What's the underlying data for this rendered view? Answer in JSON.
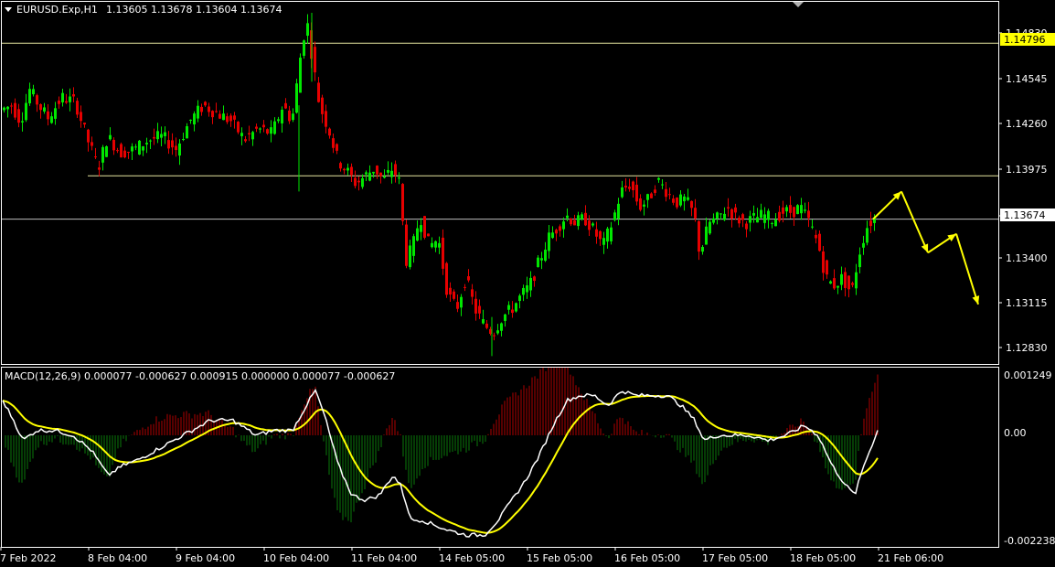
{
  "header": {
    "symbol": "EURUSD.Exp,H1",
    "quote": "1.13605 1.13678 1.13604 1.13674"
  },
  "price_axis": {
    "ticks": [
      "1.14830",
      "1.14545",
      "1.14260",
      "1.13975",
      "1.13685",
      "1.13400",
      "1.13115",
      "1.12830"
    ],
    "tag_upper": "1.14796",
    "tag_current": "1.13674"
  },
  "macd": {
    "label": "MACD(12,26,9) 0.000077 -0.000627 0.000915 0.000000 0.000077 -0.000627",
    "ticks": [
      "0.001249",
      "0.00",
      "-0.002238"
    ]
  },
  "time_axis": {
    "labels": [
      "7 Feb 2022",
      "8 Feb 04:00",
      "9 Feb 04:00",
      "10 Feb 04:00",
      "11 Feb 04:00",
      "14 Feb 05:00",
      "15 Feb 05:00",
      "16 Feb 05:00",
      "17 Feb 05:00",
      "18 Feb 05:00",
      "21 Feb 06:00"
    ]
  },
  "colors": {
    "background": "#000000",
    "bull": "#00e600",
    "bear": "#e60000",
    "frame": "#ffffff",
    "level_line": "#e6e6a0",
    "tag_upper_bg": "#ffff00",
    "arrow": "#ffff00",
    "signal_line": "#ffff00",
    "macd_line": "#ffffff"
  },
  "chart_data": {
    "type": "candlestick",
    "price_range": [
      1.1275,
      1.1506
    ],
    "macd_range": [
      -0.002238,
      0.001249
    ],
    "horizontal_levels": [
      1.14796,
      1.1395,
      1.13674
    ],
    "forecast_arrows_prices": [
      1.13674,
      1.1385,
      1.1346,
      1.1358,
      1.1313
    ]
  }
}
